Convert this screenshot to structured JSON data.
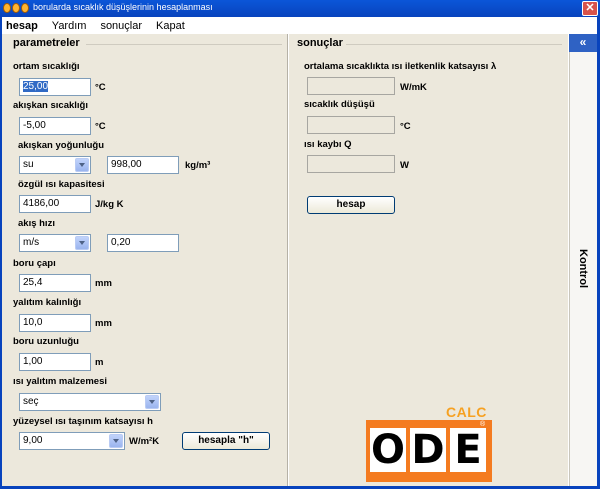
{
  "window": {
    "title": "borularda sıcaklık düşüşlerinin hesaplanması",
    "close_glyph": "✕"
  },
  "menu": {
    "items": [
      "hesap",
      "Yardım",
      "sonuçlar",
      "Kapat"
    ]
  },
  "left": {
    "section_title": "parametreler",
    "ambient_temp": {
      "label": "ortam sıcaklığı",
      "value": "25,00",
      "unit": "°C"
    },
    "fluid_temp": {
      "label": "akışkan sıcaklığı",
      "value": "-5,00",
      "unit": "°C"
    },
    "fluid_density": {
      "label": "akışkan yoğunluğu",
      "fluid": "su",
      "value": "998,00",
      "unit": "kg/m³"
    },
    "specific_heat": {
      "label": "özgül ısı kapasitesi",
      "value": "4186,00",
      "unit": "J/kg K"
    },
    "flow_rate": {
      "label": "akış hızı",
      "unit_select": "m/s",
      "value": "0,20"
    },
    "pipe_diameter": {
      "label": "boru çapı",
      "value": "25,4",
      "unit": "mm"
    },
    "insulation_thickness": {
      "label": "yalıtım kalınlığı",
      "value": "10,0",
      "unit": "mm"
    },
    "pipe_length": {
      "label": "boru uzunluğu",
      "value": "1,00",
      "unit": "m"
    },
    "insulation_material": {
      "label": "ısı yalıtım malzemesi",
      "value": "seç"
    },
    "surface_coefficient": {
      "label": "yüzeysel ısı taşınım katsayısı h",
      "value": "9,00",
      "unit": "W/m²K",
      "button": "hesapla \"h\""
    }
  },
  "right": {
    "section_title": "sonuçlar",
    "conductivity": {
      "label": "ortalama sıcaklıkta ısı iletkenlik katsayısı λ",
      "value": "",
      "unit": "W/mK"
    },
    "temp_drop": {
      "label": "sıcaklık düşüşü",
      "value": "",
      "unit": "°C"
    },
    "heat_loss": {
      "label": "ısı kaybı Q",
      "value": "",
      "unit": "W"
    },
    "calc_button": "hesap"
  },
  "side": {
    "collapse_glyph": "«",
    "label": "Kontrol"
  },
  "logo": {
    "calc": "CALC",
    "letters": [
      "O",
      "D",
      "E"
    ],
    "reg": "®"
  },
  "colors": {
    "titlebar": "#0843bd",
    "panel": "#ece8dc",
    "logo_orange": "#f47b20",
    "logo_calc": "#f6a122"
  }
}
